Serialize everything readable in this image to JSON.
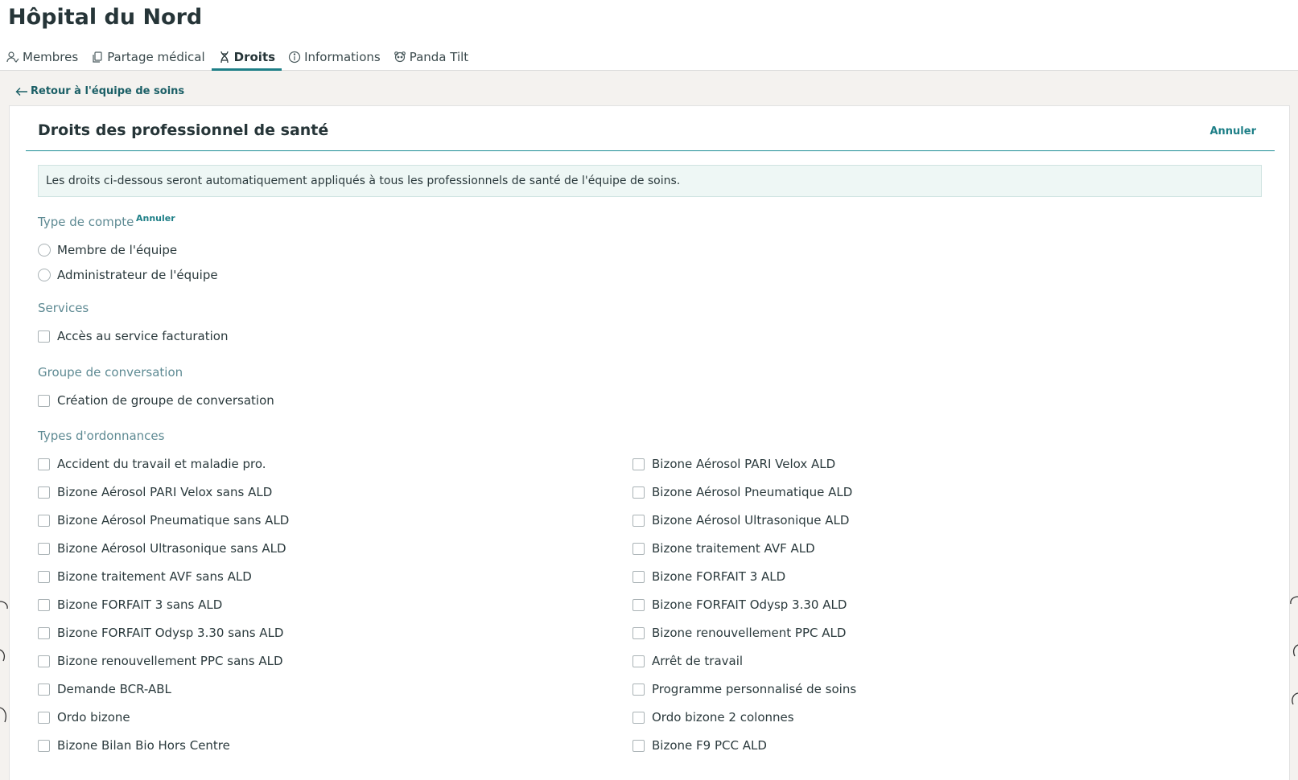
{
  "header": {
    "title": "Hôpital du Nord",
    "tabs": [
      {
        "label": "Membres",
        "icon": "members-icon",
        "active": false
      },
      {
        "label": "Partage médical",
        "icon": "copy-icon",
        "active": false
      },
      {
        "label": "Droits",
        "icon": "dna-icon",
        "active": true
      },
      {
        "label": "Informations",
        "icon": "info-icon",
        "active": false
      },
      {
        "label": "Panda Tilt",
        "icon": "panda-icon",
        "active": false
      }
    ]
  },
  "back_link": "Retour à l'équipe de soins",
  "card": {
    "title": "Droits des professionnel de santé",
    "cancel": "Annuler",
    "info": "Les droits ci-dessous seront automatiquement appliqués à tous les professionnels de santé de l'équipe de soins."
  },
  "account_type": {
    "label": "Type de compte",
    "cancel": "Annuler",
    "options": [
      "Membre de l'équipe",
      "Administrateur de l'équipe"
    ]
  },
  "services": {
    "label": "Services",
    "options": [
      "Accès au service facturation"
    ]
  },
  "conversation": {
    "label": "Groupe de conversation",
    "options": [
      "Création de groupe de conversation"
    ]
  },
  "prescriptions": {
    "label": "Types d'ordonnances",
    "left": [
      "Accident du travail et maladie pro.",
      "Bizone Aérosol PARI Velox sans ALD",
      "Bizone Aérosol Pneumatique sans ALD",
      "Bizone Aérosol Ultrasonique sans ALD",
      "Bizone traitement AVF sans ALD",
      "Bizone FORFAIT 3 sans ALD",
      "Bizone FORFAIT Odysp 3.30 sans ALD",
      "Bizone renouvellement PPC sans ALD",
      "Demande BCR-ABL",
      "Ordo bizone",
      "Bizone Bilan Bio Hors Centre"
    ],
    "right": [
      "Bizone Aérosol PARI Velox ALD",
      "Bizone Aérosol Pneumatique ALD",
      "Bizone Aérosol Ultrasonique ALD",
      "Bizone traitement AVF ALD",
      "Bizone FORFAIT 3 ALD",
      "Bizone FORFAIT Odysp 3.30 ALD",
      "Bizone renouvellement PPC ALD",
      "Arrêt de travail",
      "Programme personnalisé de soins",
      "Ordo bizone 2 colonnes",
      "Bizone F9 PCC ALD"
    ]
  },
  "colors": {
    "accent": "#1e7f87",
    "section_label": "#5e8a93",
    "info_bg": "#eef7f5",
    "page_bg": "#f4f2ef"
  }
}
